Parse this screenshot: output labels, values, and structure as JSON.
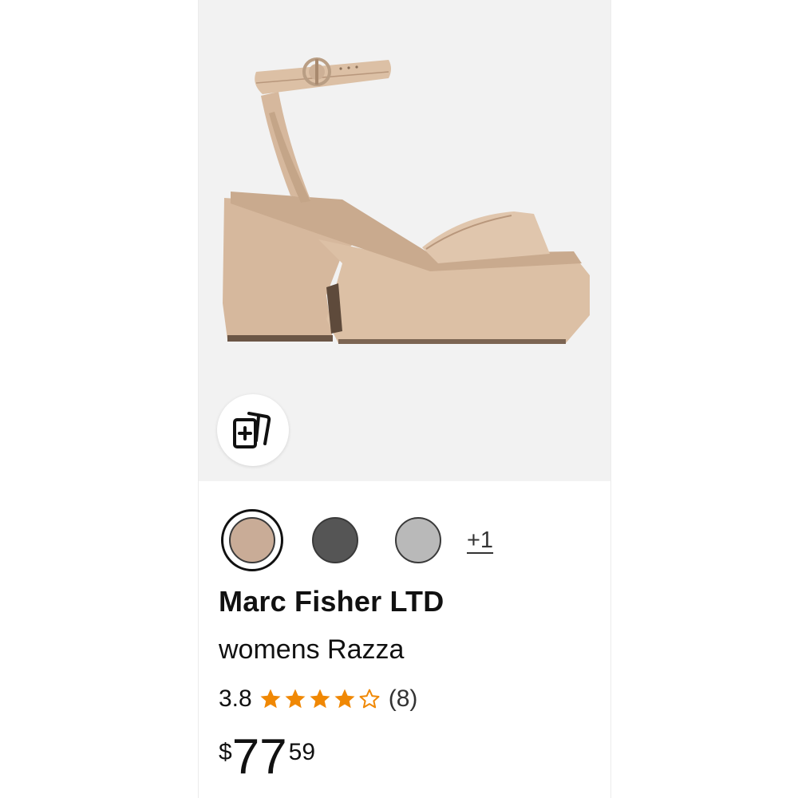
{
  "product": {
    "image_alt": "Nude platform block-heel ankle strap sandal",
    "brand": "Marc Fisher LTD",
    "title": "womens Razza",
    "rating": {
      "value": "3.8",
      "stars": 3.8,
      "count": "(8)"
    },
    "price": {
      "symbol": "$",
      "whole": "77",
      "fraction": "59"
    },
    "colors": {
      "options": [
        {
          "name": "nude",
          "hex": "#c9ac97",
          "selected": true
        },
        {
          "name": "dark-gray",
          "hex": "#555555",
          "selected": false
        },
        {
          "name": "light-gray",
          "hex": "#b9b9b9",
          "selected": false
        }
      ],
      "more_label": "+1"
    }
  },
  "actions": {
    "view_in_room_icon": "add-to-cards-icon"
  },
  "colors": {
    "star": "#f08804",
    "image_bg": "#f2f2f2",
    "text": "#111111"
  }
}
